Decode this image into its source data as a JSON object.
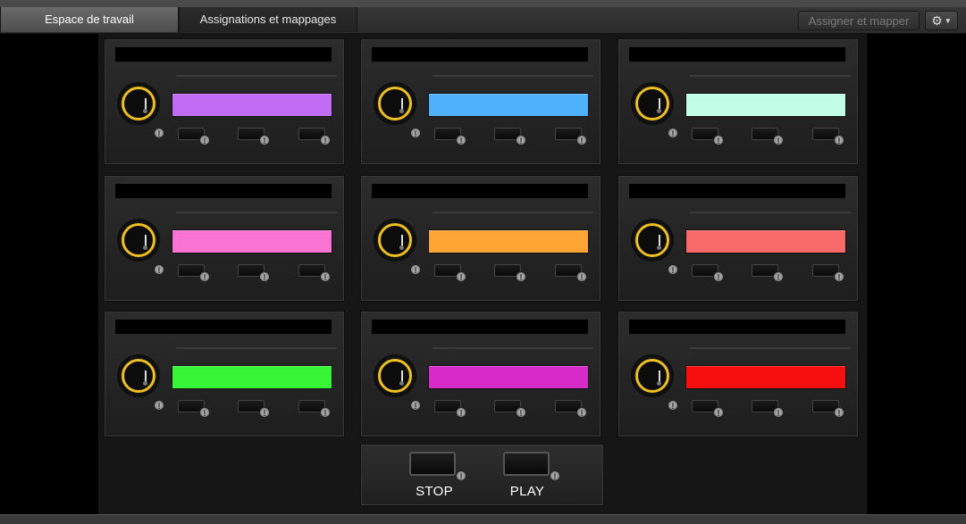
{
  "tabs": [
    {
      "label": "Espace de travail",
      "active": true
    },
    {
      "label": "Assignations et mappages",
      "active": false
    }
  ],
  "toolbar": {
    "assign_map_label": "Assigner et mapper",
    "settings_icon": "gear-icon"
  },
  "strips": [
    {
      "color": "#c06cf5"
    },
    {
      "color": "#4fb0fb"
    },
    {
      "color": "#c2fde6"
    },
    {
      "color": "#f873d2"
    },
    {
      "color": "#ffa533"
    },
    {
      "color": "#f86a6a"
    },
    {
      "color": "#37f537"
    },
    {
      "color": "#d62bc6"
    },
    {
      "color": "#f70e0e"
    }
  ],
  "transport": {
    "stop_label": "STOP",
    "play_label": "PLAY"
  },
  "info_glyph": "!"
}
